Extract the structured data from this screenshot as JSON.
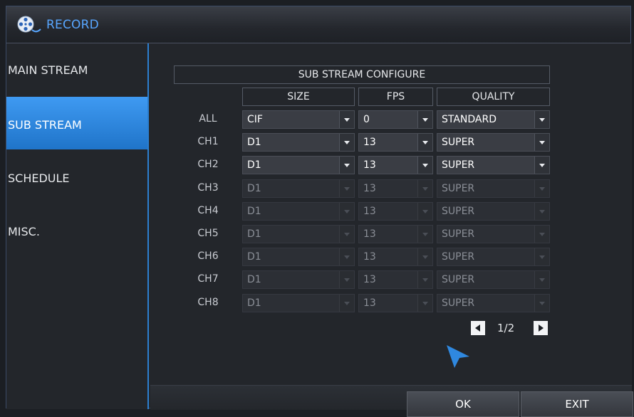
{
  "window": {
    "title": "RECORD",
    "icon": "film-reel-icon",
    "accent_color": "#58a6ff"
  },
  "sidebar": {
    "items": [
      {
        "label": "MAIN STREAM",
        "active": false
      },
      {
        "label": "SUB STREAM",
        "active": true
      },
      {
        "label": "SCHEDULE",
        "active": false
      },
      {
        "label": "MISC.",
        "active": false
      }
    ],
    "active_color": "#2f88e0"
  },
  "config": {
    "title": "SUB STREAM CONFIGURE",
    "columns": [
      "SIZE",
      "FPS",
      "QUALITY"
    ],
    "rows": [
      {
        "label": "ALL",
        "size": "CIF",
        "fps": "0",
        "quality": "STANDARD",
        "enabled": true
      },
      {
        "label": "CH1",
        "size": "D1",
        "fps": "13",
        "quality": "SUPER",
        "enabled": true
      },
      {
        "label": "CH2",
        "size": "D1",
        "fps": "13",
        "quality": "SUPER",
        "enabled": true
      },
      {
        "label": "CH3",
        "size": "D1",
        "fps": "13",
        "quality": "SUPER",
        "enabled": false
      },
      {
        "label": "CH4",
        "size": "D1",
        "fps": "13",
        "quality": "SUPER",
        "enabled": false
      },
      {
        "label": "CH5",
        "size": "D1",
        "fps": "13",
        "quality": "SUPER",
        "enabled": false
      },
      {
        "label": "CH6",
        "size": "D1",
        "fps": "13",
        "quality": "SUPER",
        "enabled": false
      },
      {
        "label": "CH7",
        "size": "D1",
        "fps": "13",
        "quality": "SUPER",
        "enabled": false
      },
      {
        "label": "CH8",
        "size": "D1",
        "fps": "13",
        "quality": "SUPER",
        "enabled": false
      }
    ]
  },
  "pager": {
    "text": "1/2",
    "prev_icon": "triangle-left-icon",
    "next_icon": "triangle-right-icon"
  },
  "buttons": {
    "ok": "OK",
    "exit": "EXIT"
  }
}
